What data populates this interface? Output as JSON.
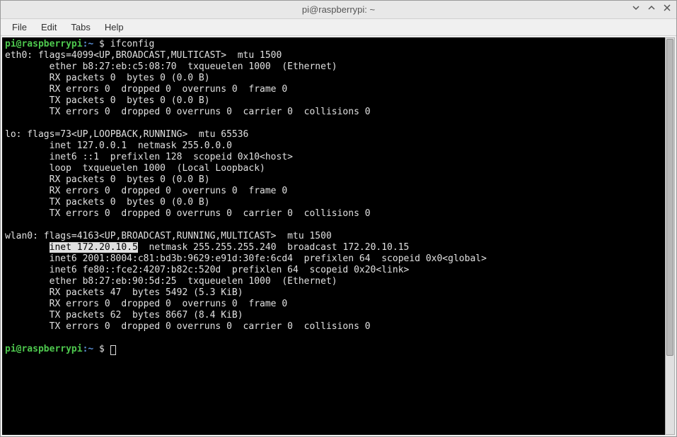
{
  "window": {
    "title": "pi@raspberrypi: ~"
  },
  "menubar": {
    "file": "File",
    "edit": "Edit",
    "tabs": "Tabs",
    "help": "Help"
  },
  "prompt": {
    "user_host": "pi@raspberrypi",
    "colon": ":",
    "path": "~",
    "dollar": " $ "
  },
  "terminal": {
    "cmd1": "ifconfig",
    "eth0_l1": "eth0: flags=4099<UP,BROADCAST,MULTICAST>  mtu 1500",
    "eth0_l2": "        ether b8:27:eb:c5:08:70  txqueuelen 1000  (Ethernet)",
    "eth0_l3": "        RX packets 0  bytes 0 (0.0 B)",
    "eth0_l4": "        RX errors 0  dropped 0  overruns 0  frame 0",
    "eth0_l5": "        TX packets 0  bytes 0 (0.0 B)",
    "eth0_l6": "        TX errors 0  dropped 0 overruns 0  carrier 0  collisions 0",
    "blank": " ",
    "lo_l1": "lo: flags=73<UP,LOOPBACK,RUNNING>  mtu 65536",
    "lo_l2": "        inet 127.0.0.1  netmask 255.0.0.0",
    "lo_l3": "        inet6 ::1  prefixlen 128  scopeid 0x10<host>",
    "lo_l4": "        loop  txqueuelen 1000  (Local Loopback)",
    "lo_l5": "        RX packets 0  bytes 0 (0.0 B)",
    "lo_l6": "        RX errors 0  dropped 0  overruns 0  frame 0",
    "lo_l7": "        TX packets 0  bytes 0 (0.0 B)",
    "lo_l8": "        TX errors 0  dropped 0 overruns 0  carrier 0  collisions 0",
    "wlan_l1": "wlan0: flags=4163<UP,BROADCAST,RUNNING,MULTICAST>  mtu 1500",
    "wlan_l2_pre": "        ",
    "wlan_l2_hl": "inet 172.20.10.5",
    "wlan_l2_post": "  netmask 255.255.255.240  broadcast 172.20.10.15",
    "wlan_l3": "        inet6 2001:8004:c81:bd3b:9629:e91d:30fe:6cd4  prefixlen 64  scopeid 0x0<global>",
    "wlan_l4": "        inet6 fe80::fce2:4207:b82c:520d  prefixlen 64  scopeid 0x20<link>",
    "wlan_l5": "        ether b8:27:eb:90:5d:25  txqueuelen 1000  (Ethernet)",
    "wlan_l6": "        RX packets 47  bytes 5492 (5.3 KiB)",
    "wlan_l7": "        RX errors 0  dropped 0  overruns 0  frame 0",
    "wlan_l8": "        TX packets 62  bytes 8667 (8.4 KiB)",
    "wlan_l9": "        TX errors 0  dropped 0 overruns 0  carrier 0  collisions 0"
  }
}
